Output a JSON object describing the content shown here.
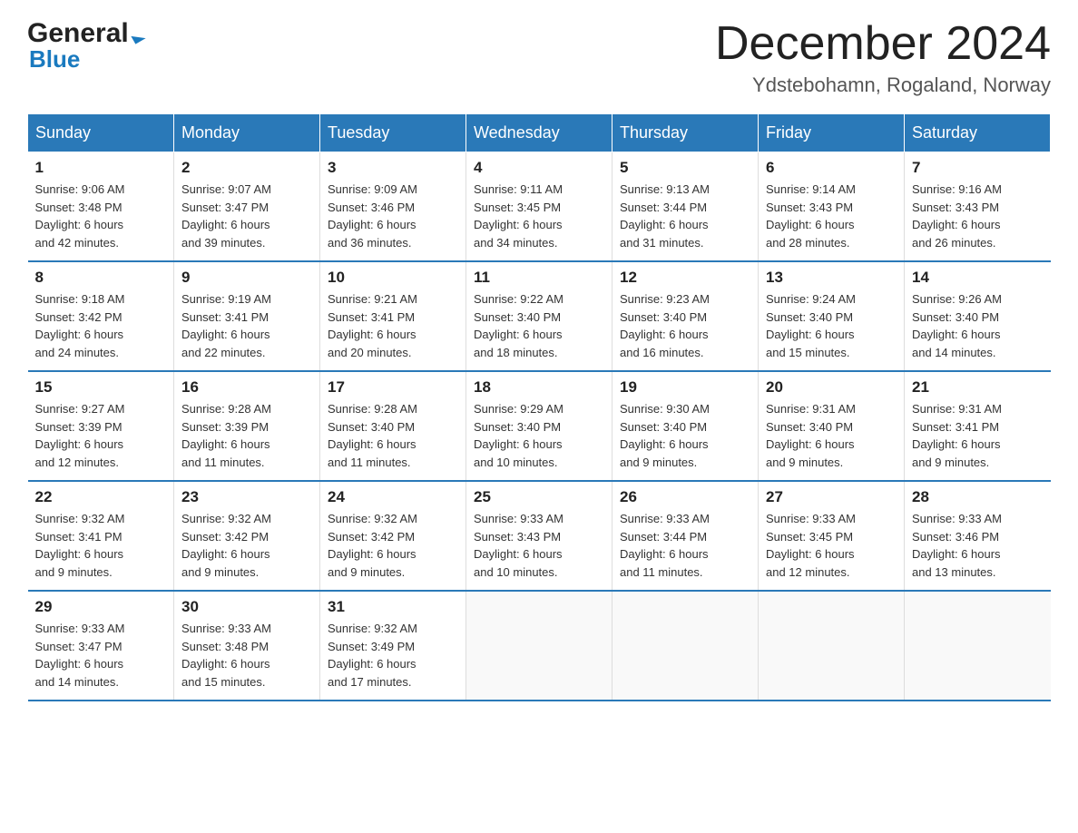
{
  "header": {
    "logo_line1": "General",
    "logo_line2": "Blue",
    "month_title": "December 2024",
    "location": "Ydstebohamn, Rogaland, Norway"
  },
  "weekdays": [
    "Sunday",
    "Monday",
    "Tuesday",
    "Wednesday",
    "Thursday",
    "Friday",
    "Saturday"
  ],
  "weeks": [
    [
      {
        "day": "1",
        "info": "Sunrise: 9:06 AM\nSunset: 3:48 PM\nDaylight: 6 hours\nand 42 minutes."
      },
      {
        "day": "2",
        "info": "Sunrise: 9:07 AM\nSunset: 3:47 PM\nDaylight: 6 hours\nand 39 minutes."
      },
      {
        "day": "3",
        "info": "Sunrise: 9:09 AM\nSunset: 3:46 PM\nDaylight: 6 hours\nand 36 minutes."
      },
      {
        "day": "4",
        "info": "Sunrise: 9:11 AM\nSunset: 3:45 PM\nDaylight: 6 hours\nand 34 minutes."
      },
      {
        "day": "5",
        "info": "Sunrise: 9:13 AM\nSunset: 3:44 PM\nDaylight: 6 hours\nand 31 minutes."
      },
      {
        "day": "6",
        "info": "Sunrise: 9:14 AM\nSunset: 3:43 PM\nDaylight: 6 hours\nand 28 minutes."
      },
      {
        "day": "7",
        "info": "Sunrise: 9:16 AM\nSunset: 3:43 PM\nDaylight: 6 hours\nand 26 minutes."
      }
    ],
    [
      {
        "day": "8",
        "info": "Sunrise: 9:18 AM\nSunset: 3:42 PM\nDaylight: 6 hours\nand 24 minutes."
      },
      {
        "day": "9",
        "info": "Sunrise: 9:19 AM\nSunset: 3:41 PM\nDaylight: 6 hours\nand 22 minutes."
      },
      {
        "day": "10",
        "info": "Sunrise: 9:21 AM\nSunset: 3:41 PM\nDaylight: 6 hours\nand 20 minutes."
      },
      {
        "day": "11",
        "info": "Sunrise: 9:22 AM\nSunset: 3:40 PM\nDaylight: 6 hours\nand 18 minutes."
      },
      {
        "day": "12",
        "info": "Sunrise: 9:23 AM\nSunset: 3:40 PM\nDaylight: 6 hours\nand 16 minutes."
      },
      {
        "day": "13",
        "info": "Sunrise: 9:24 AM\nSunset: 3:40 PM\nDaylight: 6 hours\nand 15 minutes."
      },
      {
        "day": "14",
        "info": "Sunrise: 9:26 AM\nSunset: 3:40 PM\nDaylight: 6 hours\nand 14 minutes."
      }
    ],
    [
      {
        "day": "15",
        "info": "Sunrise: 9:27 AM\nSunset: 3:39 PM\nDaylight: 6 hours\nand 12 minutes."
      },
      {
        "day": "16",
        "info": "Sunrise: 9:28 AM\nSunset: 3:39 PM\nDaylight: 6 hours\nand 11 minutes."
      },
      {
        "day": "17",
        "info": "Sunrise: 9:28 AM\nSunset: 3:40 PM\nDaylight: 6 hours\nand 11 minutes."
      },
      {
        "day": "18",
        "info": "Sunrise: 9:29 AM\nSunset: 3:40 PM\nDaylight: 6 hours\nand 10 minutes."
      },
      {
        "day": "19",
        "info": "Sunrise: 9:30 AM\nSunset: 3:40 PM\nDaylight: 6 hours\nand 9 minutes."
      },
      {
        "day": "20",
        "info": "Sunrise: 9:31 AM\nSunset: 3:40 PM\nDaylight: 6 hours\nand 9 minutes."
      },
      {
        "day": "21",
        "info": "Sunrise: 9:31 AM\nSunset: 3:41 PM\nDaylight: 6 hours\nand 9 minutes."
      }
    ],
    [
      {
        "day": "22",
        "info": "Sunrise: 9:32 AM\nSunset: 3:41 PM\nDaylight: 6 hours\nand 9 minutes."
      },
      {
        "day": "23",
        "info": "Sunrise: 9:32 AM\nSunset: 3:42 PM\nDaylight: 6 hours\nand 9 minutes."
      },
      {
        "day": "24",
        "info": "Sunrise: 9:32 AM\nSunset: 3:42 PM\nDaylight: 6 hours\nand 9 minutes."
      },
      {
        "day": "25",
        "info": "Sunrise: 9:33 AM\nSunset: 3:43 PM\nDaylight: 6 hours\nand 10 minutes."
      },
      {
        "day": "26",
        "info": "Sunrise: 9:33 AM\nSunset: 3:44 PM\nDaylight: 6 hours\nand 11 minutes."
      },
      {
        "day": "27",
        "info": "Sunrise: 9:33 AM\nSunset: 3:45 PM\nDaylight: 6 hours\nand 12 minutes."
      },
      {
        "day": "28",
        "info": "Sunrise: 9:33 AM\nSunset: 3:46 PM\nDaylight: 6 hours\nand 13 minutes."
      }
    ],
    [
      {
        "day": "29",
        "info": "Sunrise: 9:33 AM\nSunset: 3:47 PM\nDaylight: 6 hours\nand 14 minutes."
      },
      {
        "day": "30",
        "info": "Sunrise: 9:33 AM\nSunset: 3:48 PM\nDaylight: 6 hours\nand 15 minutes."
      },
      {
        "day": "31",
        "info": "Sunrise: 9:32 AM\nSunset: 3:49 PM\nDaylight: 6 hours\nand 17 minutes."
      },
      null,
      null,
      null,
      null
    ]
  ]
}
